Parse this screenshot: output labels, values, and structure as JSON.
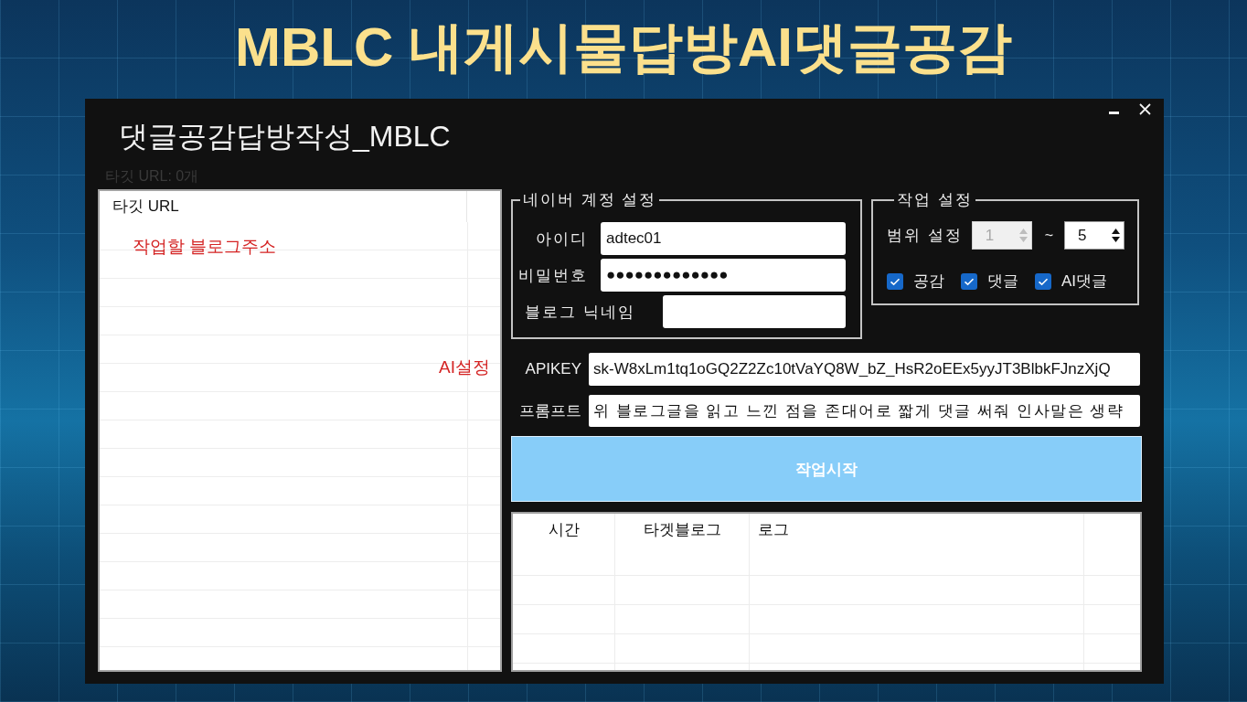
{
  "banner": {
    "title": "MBLC 내게시물답방AI댓글공감"
  },
  "window": {
    "title": "댓글공감답방작성_MBLC"
  },
  "url_count": "타깃 URL: 0개",
  "url_list": {
    "columns": [
      "타깃 URL"
    ]
  },
  "annotations": [
    "작업할 블로그주소",
    "AI설정"
  ],
  "account_settings": {
    "title": "네이버 계정 설정",
    "fields": [
      {
        "label": "아이디",
        "value": "adtec01"
      },
      {
        "label": "비밀번호",
        "value": "●●●●●●●●●●●●●"
      },
      {
        "label": "블로그 닉네임"
      }
    ]
  },
  "work_settings": {
    "title": "작업 설정",
    "range": {
      "label": "범위 설정",
      "from": {
        "value": "1",
        "disabled": true
      },
      "separator": "~",
      "to": {
        "value": "5",
        "disabled": false
      }
    },
    "options": [
      {
        "label": "공감",
        "checked": true
      },
      {
        "label": "댓글",
        "checked": true
      },
      {
        "label": "AI댓글",
        "checked": true
      }
    ]
  },
  "ai_settings": {
    "fields": [
      {
        "label": "APIKEY",
        "value": "sk-W8xLm1tq1oGQ2Z2Zc10tVaYQ8W_bZ_HsR2oEEx5yyJT3BlbkFJnzXjQ"
      },
      {
        "label": "프롬프트",
        "value": "위 블로그글을 읽고 느낀 점을 존대어로 짧게 댓글 써줘 인사말은 생략"
      }
    ]
  },
  "start_button": {
    "label": "작업시작"
  },
  "log_table": {
    "columns": [
      "시간",
      "타겟블로그",
      "로그"
    ]
  }
}
